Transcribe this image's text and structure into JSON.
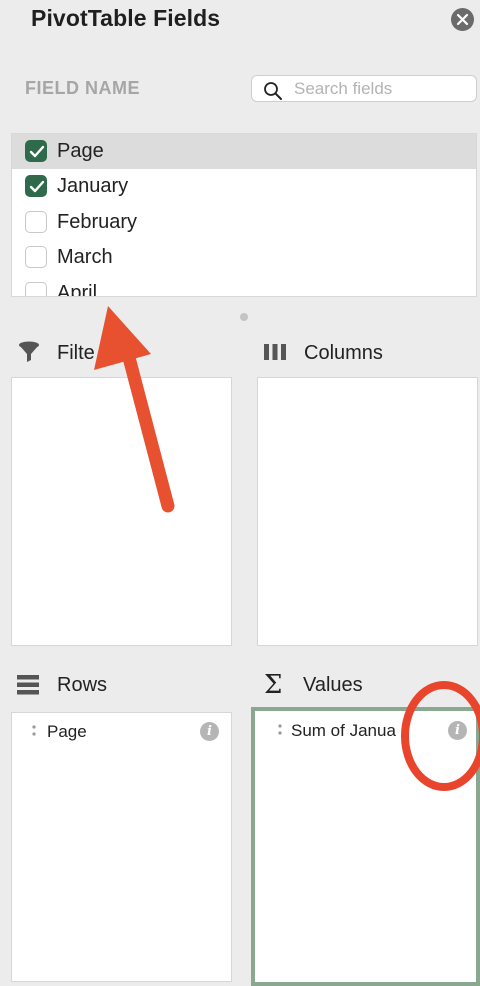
{
  "panel": {
    "title": "PivotTable Fields",
    "close_icon": "close-icon"
  },
  "field_list": {
    "header_label": "FIELD NAME",
    "search_placeholder": "Search fields",
    "search_value": "",
    "fields": [
      {
        "label": "Page",
        "checked": true,
        "selected": true
      },
      {
        "label": "January",
        "checked": true,
        "selected": false
      },
      {
        "label": "February",
        "checked": false,
        "selected": false
      },
      {
        "label": "March",
        "checked": false,
        "selected": false
      },
      {
        "label": "April",
        "checked": false,
        "selected": false
      }
    ]
  },
  "areas": {
    "filters": {
      "label": "Filte",
      "icon": "filter-icon",
      "items": []
    },
    "columns": {
      "label": "Columns",
      "icon": "columns-icon",
      "items": []
    },
    "rows": {
      "label": "Rows",
      "icon": "rows-icon",
      "items": [
        {
          "label": "Page"
        }
      ]
    },
    "values": {
      "label": "Values",
      "icon": "sigma-icon",
      "items": [
        {
          "label": "Sum of Janua"
        }
      ]
    }
  },
  "annotations": {
    "arrow_color": "#e8512f",
    "circle_color": "#e8452c"
  },
  "colors": {
    "checkbox_checked": "#2f6b4b",
    "active_area_border": "#8aa88f",
    "panel_background": "#ececec"
  }
}
